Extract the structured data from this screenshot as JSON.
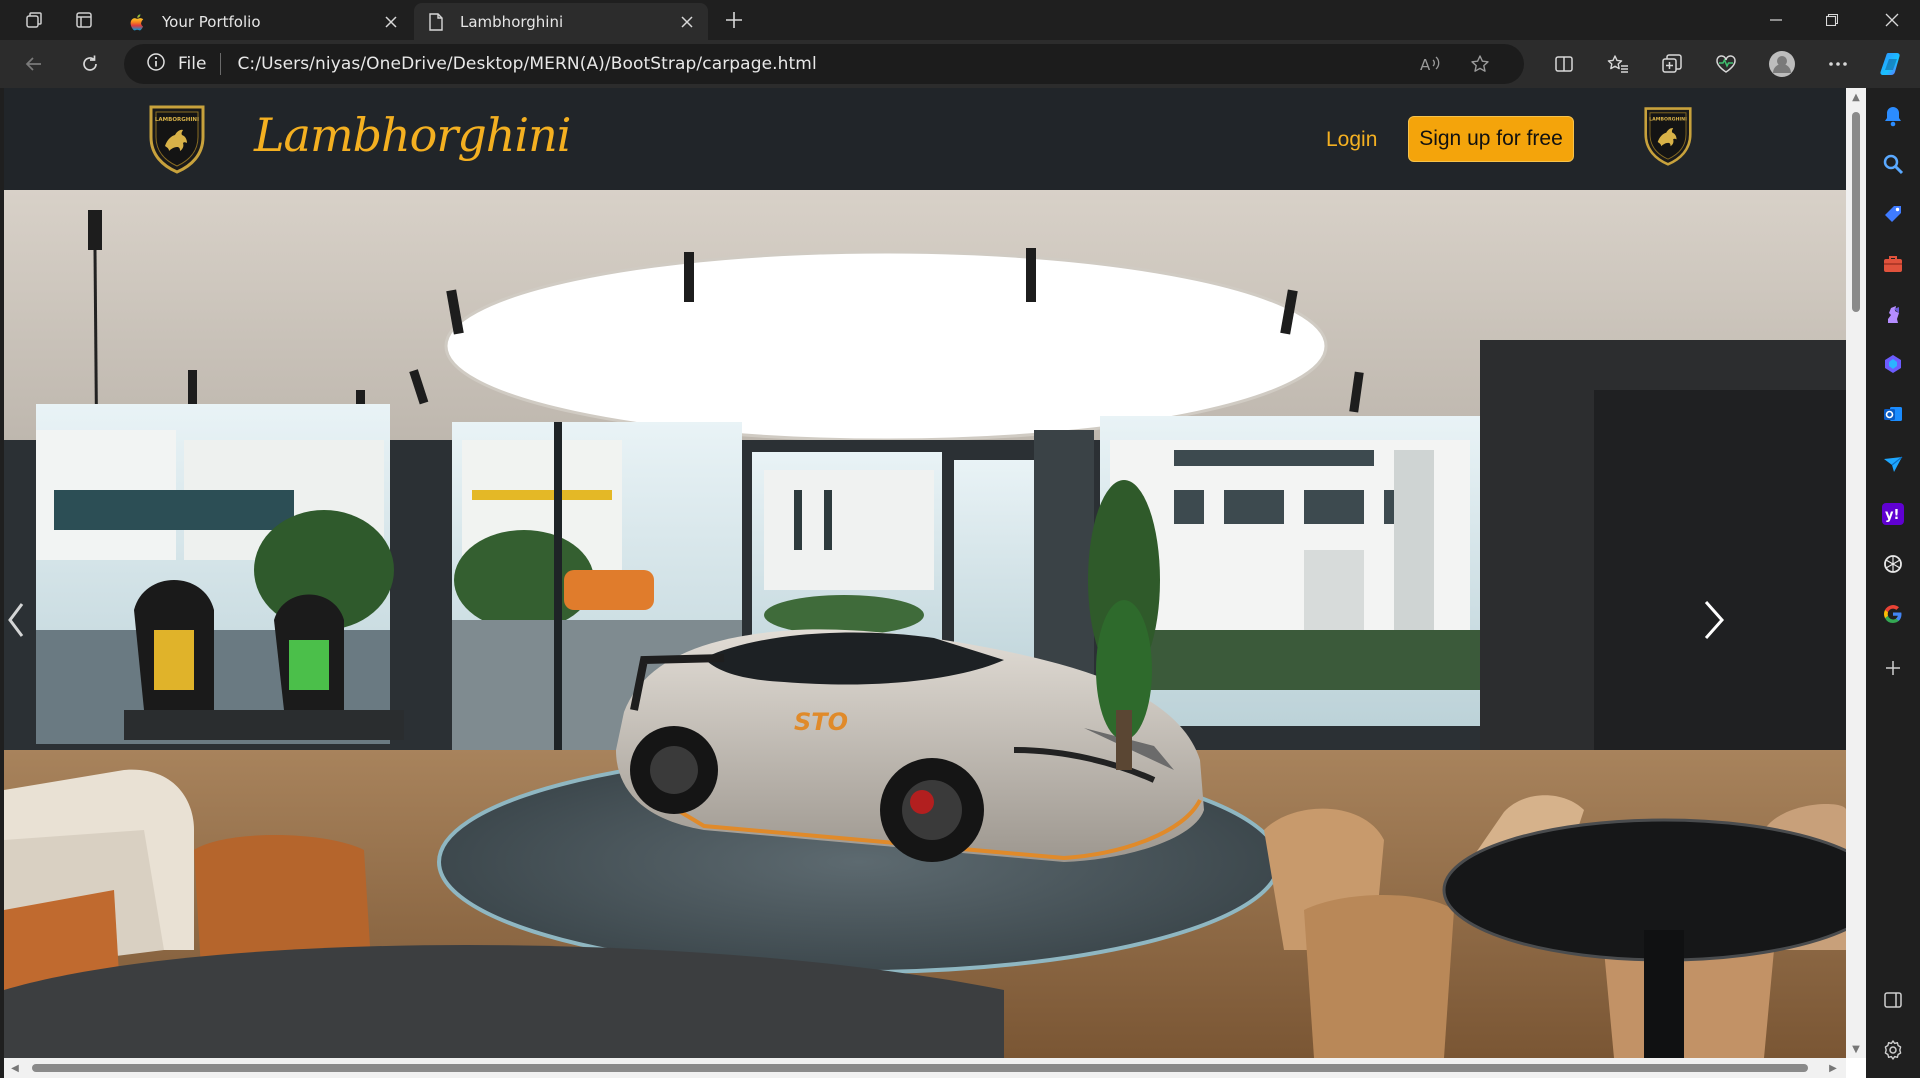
{
  "browser": {
    "tabs": [
      {
        "label": "Your Portfolio",
        "favicon": "apple-logo-icon",
        "active": false
      },
      {
        "label": "Lambhorghini",
        "favicon": "page-icon",
        "active": true
      }
    ],
    "address": {
      "scheme_label": "File",
      "url": "C:/Users/niyas/OneDrive/Desktop/MERN(A)/BootStrap/carpage.html"
    },
    "edge_sidebar": [
      "bell-icon",
      "search-icon",
      "tag-icon",
      "briefcase-icon",
      "chess-icon",
      "copilot-icon",
      "outlook-icon",
      "send-icon",
      "yahoo-icon",
      "openai-icon",
      "google-icon",
      "add-icon",
      "split-view-icon",
      "settings-icon"
    ]
  },
  "page": {
    "brand": "Lambhorghini",
    "nav": {
      "login_label": "Login",
      "signup_label": "Sign up for free"
    },
    "hero": {
      "image": "lamborghini-showroom-photo",
      "car_badge": "STO"
    },
    "colors": {
      "accent": "#f4a40b",
      "navbar": "#212529"
    }
  }
}
